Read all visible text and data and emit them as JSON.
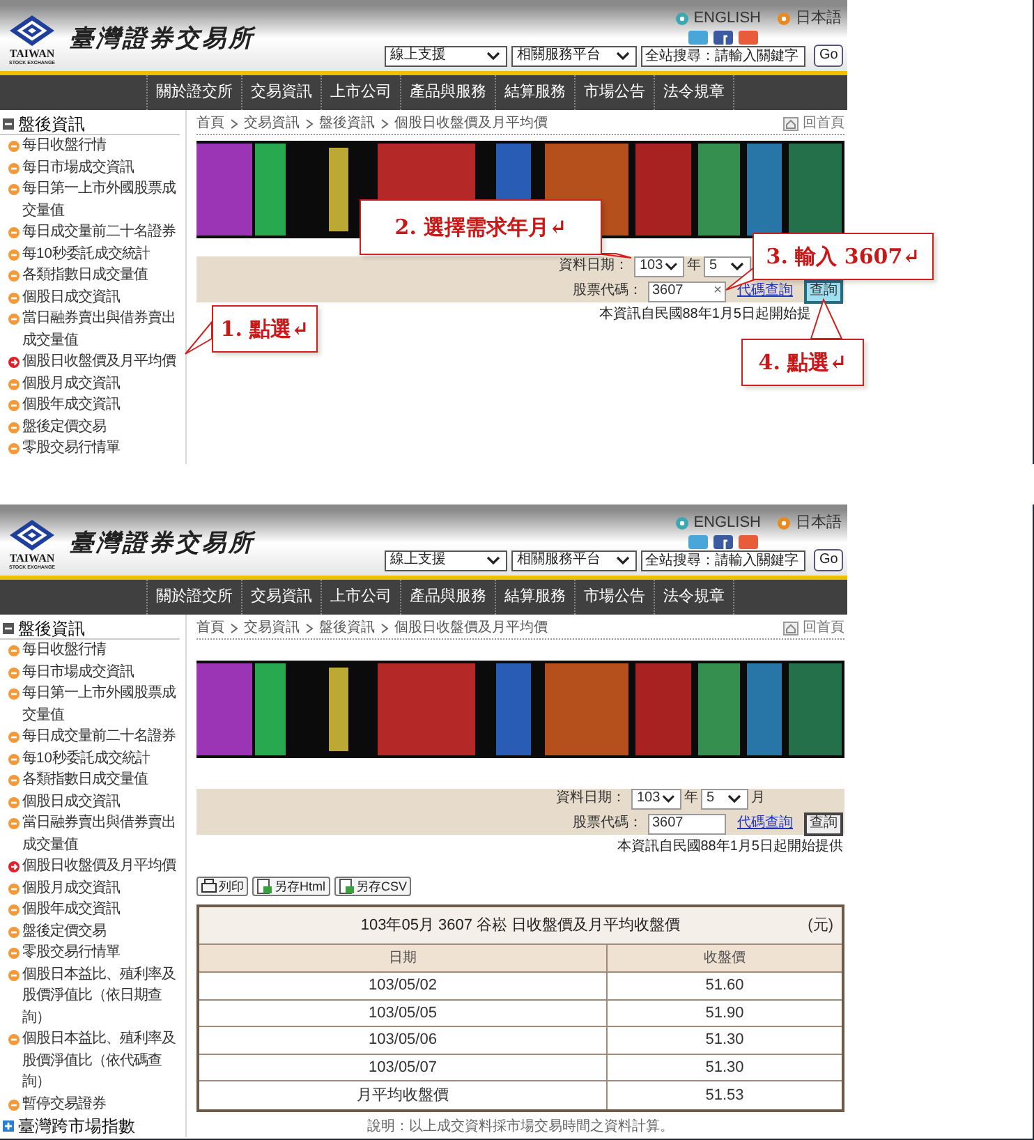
{
  "panels": [
    {
      "header": {
        "logo_text": "TAIWAN",
        "logo_subtext": "STOCK EXCHANGE",
        "site_name": "臺灣證券交易所",
        "language_links": [
          "ENGLISH",
          "日本語"
        ],
        "dropdowns": [
          "線上支援",
          "相關服務平台"
        ],
        "search": {
          "placeholder": "全站搜尋：請輸入關鍵字"
        },
        "search_button": "Go"
      },
      "nav": [
        "關於證交所",
        "交易資訊",
        "上市公司",
        "產品與服務",
        "結算服務",
        "市場公告",
        "法令規章"
      ],
      "sidebar": [
        {
          "title": "盤後資訊",
          "expanded": true,
          "items": [
            {
              "label": "每日收盤行情",
              "selected": false
            },
            {
              "label": "每日市場成交資訊",
              "selected": false
            },
            {
              "label": "每日第一上市外國股票成交量值",
              "selected": false
            },
            {
              "label": "每日成交量前二十名證券",
              "selected": false
            },
            {
              "label": "每10秒委託成交統計",
              "selected": false
            },
            {
              "label": "各類指數日成交量值",
              "selected": false
            },
            {
              "label": "個股日成交資訊",
              "selected": false
            },
            {
              "label": "當日融券賣出與借券賣出成交量值",
              "selected": false
            },
            {
              "label": "個股日收盤價及月平均價",
              "selected": true
            },
            {
              "label": "個股月成交資訊",
              "selected": false
            },
            {
              "label": "個股年成交資訊",
              "selected": false
            },
            {
              "label": "盤後定價交易",
              "selected": false
            },
            {
              "label": "零股交易行情單",
              "selected": false
            }
          ]
        }
      ],
      "breadcrumb": [
        "首頁",
        "交易資訊",
        "盤後資訊",
        "個股日收盤價及月平均價"
      ],
      "home_link": "回首頁",
      "form": {
        "date_label": "資料日期：",
        "year": "103",
        "year_unit": "年",
        "month": "5",
        "code_label": "股票代碼：",
        "code": "3607",
        "clear_button": "×",
        "lookup_link": "代碼查詢",
        "query_button": "查詢",
        "query_highlighted": true
      },
      "note": "本資訊自民國88年1月5日起開始提",
      "callouts": [
        "1. 點選↵",
        "2. 選擇需求年月↵",
        "3. 輸入 3607↵",
        "4. 點選↵"
      ]
    },
    {
      "header": {
        "logo_text": "TAIWAN",
        "logo_subtext": "STOCK EXCHANGE",
        "site_name": "臺灣證券交易所",
        "language_links": [
          "ENGLISH",
          "日本語"
        ],
        "dropdowns": [
          "線上支援",
          "相關服務平台"
        ],
        "search": {
          "placeholder": "全站搜尋：請輸入關鍵字"
        },
        "search_button": "Go"
      },
      "nav": [
        "關於證交所",
        "交易資訊",
        "上市公司",
        "產品與服務",
        "結算服務",
        "市場公告",
        "法令規章"
      ],
      "sidebar": [
        {
          "title": "盤後資訊",
          "expanded": true,
          "items": [
            {
              "label": "每日收盤行情",
              "selected": false
            },
            {
              "label": "每日市場成交資訊",
              "selected": false
            },
            {
              "label": "每日第一上市外國股票成交量值",
              "selected": false
            },
            {
              "label": "每日成交量前二十名證券",
              "selected": false
            },
            {
              "label": "每10秒委託成交統計",
              "selected": false
            },
            {
              "label": "各類指數日成交量值",
              "selected": false
            },
            {
              "label": "個股日成交資訊",
              "selected": false
            },
            {
              "label": "當日融券賣出與借券賣出成交量值",
              "selected": false
            },
            {
              "label": "個股日收盤價及月平均價",
              "selected": true
            },
            {
              "label": "個股月成交資訊",
              "selected": false
            },
            {
              "label": "個股年成交資訊",
              "selected": false
            },
            {
              "label": "盤後定價交易",
              "selected": false
            },
            {
              "label": "零股交易行情單",
              "selected": false
            },
            {
              "label": "個股日本益比、殖利率及股價淨值比（依日期查詢）",
              "selected": false
            },
            {
              "label": "個股日本益比、殖利率及股價淨值比（依代碼查詢）",
              "selected": false
            },
            {
              "label": "暫停交易證券",
              "selected": false
            }
          ]
        },
        {
          "title": "臺灣跨市場指數",
          "expanded": false
        }
      ],
      "breadcrumb": [
        "首頁",
        "交易資訊",
        "盤後資訊",
        "個股日收盤價及月平均價"
      ],
      "home_link": "回首頁",
      "form": {
        "date_label": "資料日期：",
        "year": "103",
        "year_unit": "年",
        "month": "5",
        "month_unit": "月",
        "code_label": "股票代碼：",
        "code": "3607",
        "lookup_link": "代碼查詢",
        "query_button": "查詢",
        "query_highlighted": false
      },
      "note": "本資訊自民國88年1月5日起開始提供",
      "export_buttons": [
        "列印",
        "另存Html",
        "另存CSV"
      ],
      "results": {
        "title": "103年05月 3607 谷崧 日收盤價及月平均收盤價",
        "unit": "(元)",
        "columns": [
          "日期",
          "收盤價"
        ],
        "rows": [
          [
            "103/05/02",
            "51.60"
          ],
          [
            "103/05/05",
            "51.90"
          ],
          [
            "103/05/06",
            "51.30"
          ],
          [
            "103/05/07",
            "51.30"
          ],
          [
            "月平均收盤價",
            "51.53"
          ]
        ],
        "footnote": "說明：以上成交資料採市場交易時間之資料計算。"
      }
    }
  ]
}
